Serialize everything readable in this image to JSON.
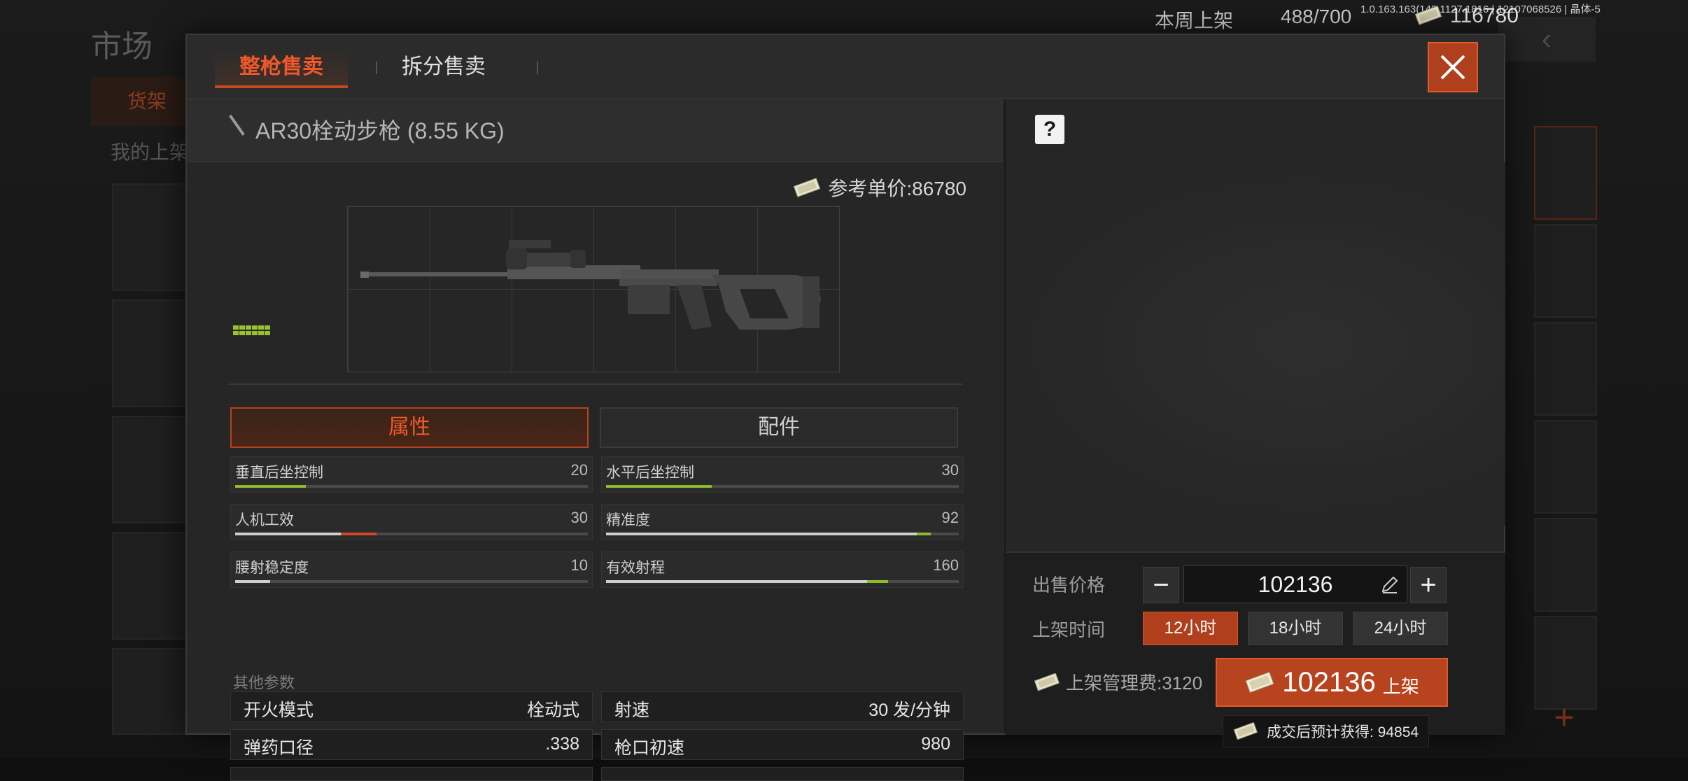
{
  "background": {
    "title": "市场",
    "tab": "货架",
    "subtitle": "我的上架"
  },
  "topbar": {
    "weekly_label": "本周上架",
    "weekly_count": "488/700",
    "version": "1.0.163.163(143.1127.1816 | 12107068526 | 晶体-5",
    "cash": "116780"
  },
  "modal": {
    "tabs": [
      {
        "label": "整枪售卖",
        "active": true
      },
      {
        "label": "拆分售卖",
        "active": false
      }
    ],
    "item": {
      "name": "AR30栓动步枪 (8.55 KG)",
      "ref_price": "参考单价:86780"
    },
    "section_tabs": [
      {
        "label": "属性",
        "active": true
      },
      {
        "label": "配件",
        "active": false
      }
    ],
    "stats": [
      {
        "label": "垂直后坐控制",
        "value": "20",
        "level": 0.2,
        "color": "#8dbb2a"
      },
      {
        "label": "水平后坐控制",
        "value": "30",
        "level": 0.3,
        "color": "#8dbb2a"
      },
      {
        "label": "人机工效",
        "value": "30",
        "level": 0.4,
        "color": "#d0472a",
        "base": 0.3
      },
      {
        "label": "精准度",
        "value": "92",
        "level": 0.92,
        "color": "#8dbb2a",
        "base": 0.88
      },
      {
        "label": "腰射稳定度",
        "value": "10",
        "level": 0.1,
        "color": "#cfcfcf"
      },
      {
        "label": "有效射程",
        "value": "160",
        "level": 0.8,
        "color": "#8dbb2a",
        "base": 0.74
      }
    ],
    "other_label": "其他参数",
    "params": [
      {
        "key": "开火模式",
        "value": "栓动式"
      },
      {
        "key": "射速",
        "value": "30 发/分钟"
      },
      {
        "key": "弹药口径",
        "value": ".338"
      },
      {
        "key": "枪口初速",
        "value": "980"
      }
    ],
    "sell": {
      "price_label": "出售价格",
      "price": "102136",
      "duration_label": "上架时间",
      "durations": [
        "12小时",
        "18小时",
        "24小时"
      ],
      "fee": "上架管理费:3120",
      "list_amount": "102136",
      "list_text": "上架",
      "estimate": "成交后预计获得: 94854"
    },
    "help": "?"
  }
}
